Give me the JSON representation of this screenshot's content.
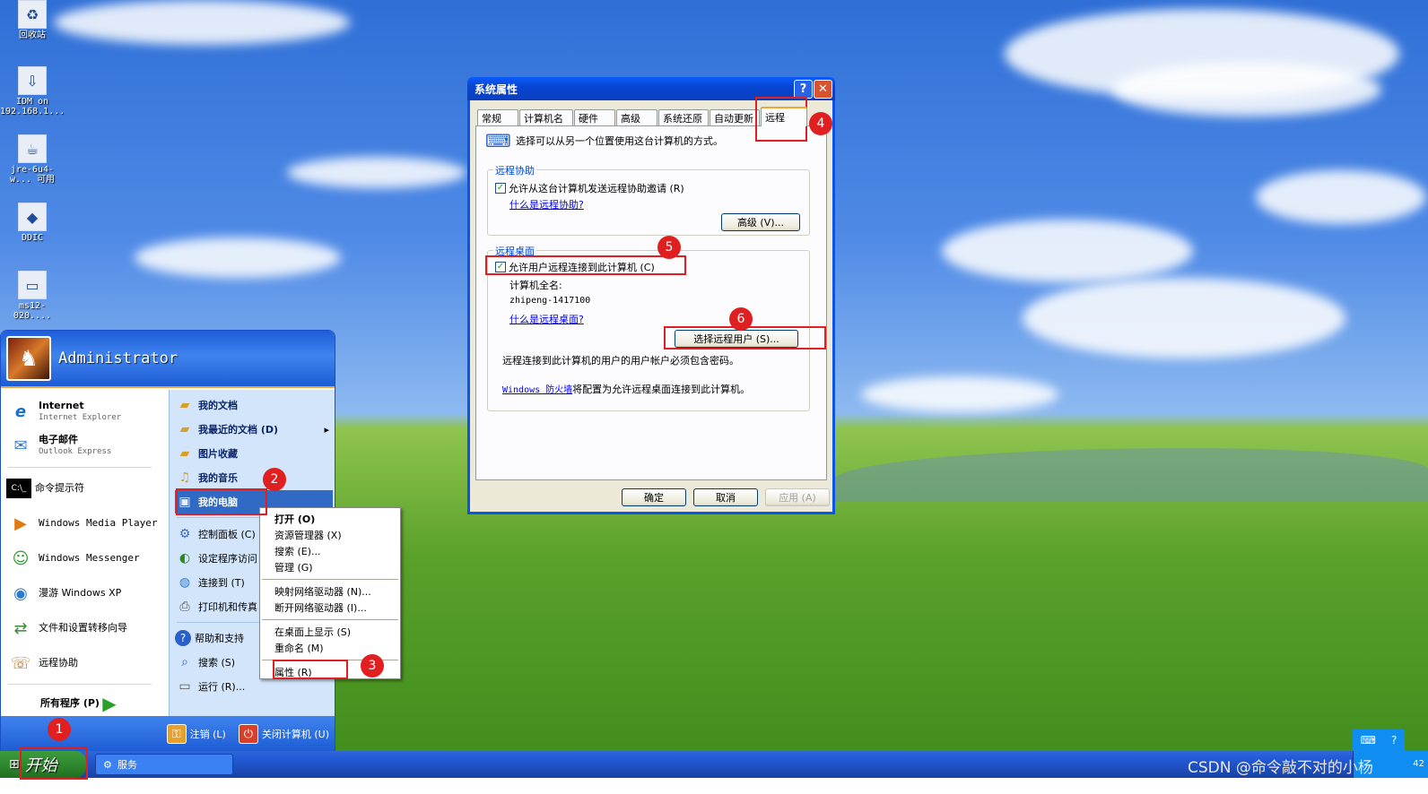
{
  "desktop": {
    "icons": [
      {
        "icon": "recycle-bin-icon",
        "glyph": "♻",
        "label": "回收站"
      },
      {
        "icon": "idm-icon",
        "glyph": "⇩",
        "label": "IDM on 192.168.1..."
      },
      {
        "icon": "java-icon",
        "glyph": "☕",
        "label": "jre-6u4-w... 可用"
      },
      {
        "icon": "ddic-icon",
        "glyph": "◆",
        "label": "DDIC"
      },
      {
        "icon": "window-file-icon",
        "glyph": "▭",
        "label": "ms12-020...."
      }
    ]
  },
  "start_menu": {
    "user": "Administrator",
    "pinned": [
      {
        "title": "Internet",
        "sub": "Internet Explorer",
        "glyph": "e",
        "color": "#1b6fd1"
      },
      {
        "title": "电子邮件",
        "sub": "Outlook Express",
        "glyph": "✉",
        "color": "#3b7bd1"
      }
    ],
    "recent": [
      {
        "label": "命令提示符",
        "glyph": "▶",
        "color": "#000"
      },
      {
        "label": "Windows Media Player",
        "glyph": "▶",
        "color": "#e27a12"
      },
      {
        "label": "Windows Messenger",
        "glyph": "☺",
        "color": "#2a9a2a"
      },
      {
        "label": "漫游 Windows XP",
        "glyph": "◉",
        "color": "#2a7ad0"
      },
      {
        "label": "文件和设置转移向导",
        "glyph": "⇄",
        "color": "#3a8a3a"
      },
      {
        "label": "远程协助",
        "glyph": "☏",
        "color": "#c07a20"
      }
    ],
    "all_programs": "所有程序 (P)",
    "right": [
      {
        "label": "我的文档",
        "glyph": "📁",
        "bold": true
      },
      {
        "label": "我最近的文档 (D)",
        "glyph": "📁",
        "bold": true,
        "arrow": "▸"
      },
      {
        "label": "图片收藏",
        "glyph": "📁",
        "bold": true
      },
      {
        "label": "我的音乐",
        "glyph": "♫",
        "bold": true
      },
      {
        "label": "我的电脑",
        "glyph": "🖥",
        "bold": true,
        "highlight": true
      },
      {
        "label": "控制面板 (C)",
        "glyph": "⚙"
      },
      {
        "label": "设定程序访问",
        "glyph": "◐"
      },
      {
        "label": "连接到 (T)",
        "glyph": "🌐"
      },
      {
        "label": "打印机和传真",
        "glyph": "🖶"
      },
      {
        "label": "帮助和支持",
        "glyph": "?"
      },
      {
        "label": "搜索 (S)",
        "glyph": "🔍"
      },
      {
        "label": "运行 (R)...",
        "glyph": "▭"
      }
    ],
    "logoff": "注销 (L)",
    "shutdown": "关闭计算机 (U)"
  },
  "context_menu": {
    "items": [
      {
        "label": "打开 (O)",
        "bold": true
      },
      {
        "label": "资源管理器 (X)"
      },
      {
        "label": "搜索 (E)..."
      },
      {
        "label": "管理 (G)"
      },
      {
        "sep": true
      },
      {
        "label": "映射网络驱动器 (N)..."
      },
      {
        "label": "断开网络驱动器 (I)..."
      },
      {
        "sep": true
      },
      {
        "label": "在桌面上显示 (S)"
      },
      {
        "label": "重命名 (M)"
      },
      {
        "sep": true
      },
      {
        "label": "属性 (R)"
      }
    ]
  },
  "taskbar": {
    "start": "开始",
    "task": "服务",
    "watermark": "CSDN @命令敲不对的小杨",
    "clock": "42"
  },
  "dialog": {
    "title": "系统属性",
    "help": "?",
    "close": "✕",
    "tabs": [
      "常规",
      "计算机名",
      "硬件",
      "高级",
      "系统还原",
      "自动更新",
      "远程"
    ],
    "active_tab": "远程",
    "intro": "选择可以从另一个位置使用这台计算机的方式。",
    "assist": {
      "legend": "远程协助",
      "checkbox": "允许从这台计算机发送远程协助邀请 (R)",
      "checked": true,
      "link": "什么是远程协助?",
      "advanced": "高级 (V)..."
    },
    "desktop": {
      "legend": "远程桌面",
      "checkbox": "允许用户远程连接到此计算机 (C)",
      "checked": true,
      "full_name_label": "计算机全名:",
      "full_name": "zhipeng-1417100",
      "link": "什么是远程桌面?",
      "select_users": "选择远程用户 (S)...",
      "note": "远程连接到此计算机的用户的用户帐户必须包含密码。",
      "firewall_link": "Windows 防火墙",
      "firewall_text": "将配置为允许远程桌面连接到此计算机。"
    },
    "ok": "确定",
    "cancel": "取消",
    "apply": "应用 (A)"
  },
  "annotations": [
    "1",
    "2",
    "3",
    "4",
    "5",
    "6"
  ]
}
